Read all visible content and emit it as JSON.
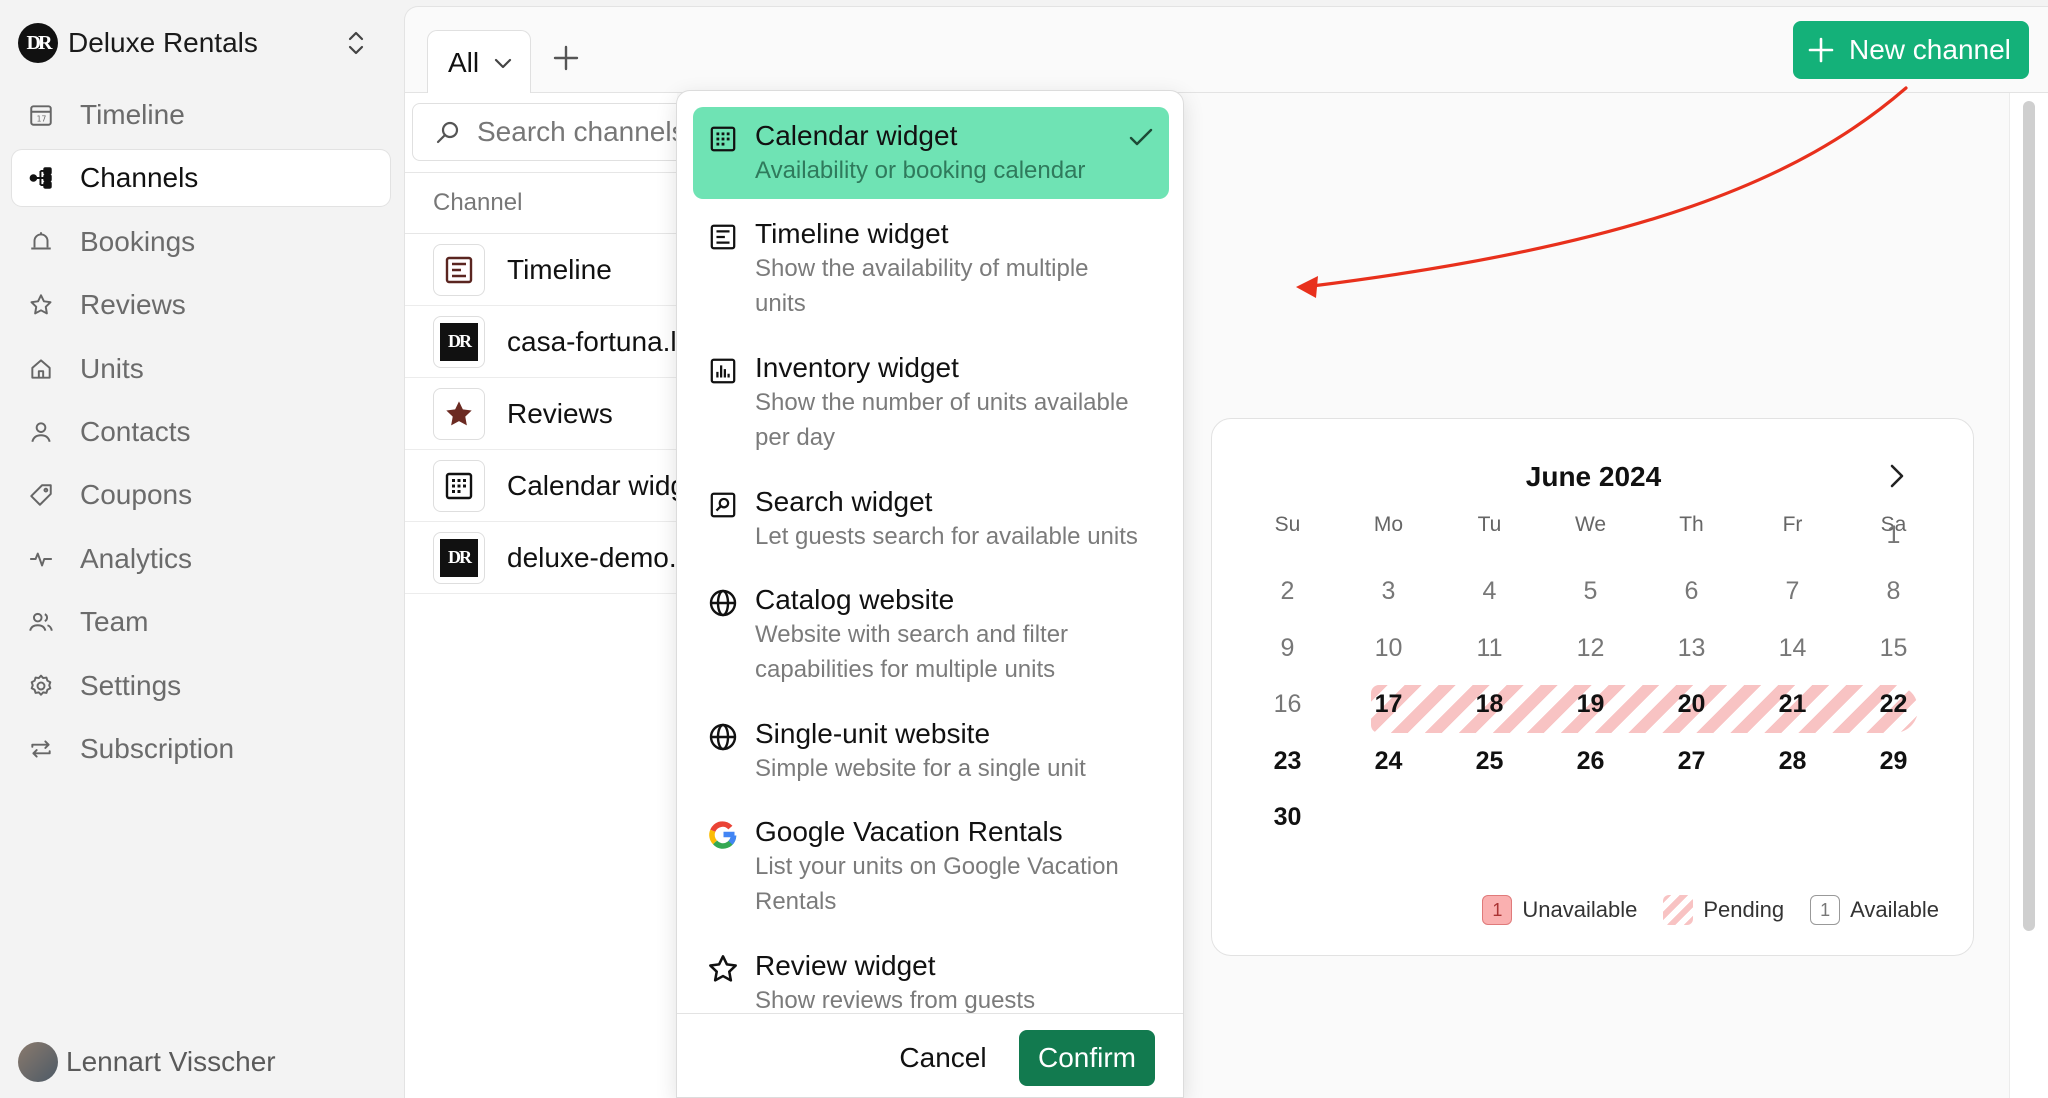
{
  "app": {
    "brand": "Deluxe Rentals",
    "logo_text": "DR",
    "user_name": "Lennart Visscher"
  },
  "sidebar": {
    "items": [
      {
        "label": "Timeline",
        "icon": "calendar-icon",
        "active": false
      },
      {
        "label": "Channels",
        "icon": "channels-icon",
        "active": true
      },
      {
        "label": "Bookings",
        "icon": "bell-icon",
        "active": false
      },
      {
        "label": "Reviews",
        "icon": "star-icon",
        "active": false
      },
      {
        "label": "Units",
        "icon": "home-icon",
        "active": false
      },
      {
        "label": "Contacts",
        "icon": "user-icon",
        "active": false
      },
      {
        "label": "Coupons",
        "icon": "tag-icon",
        "active": false
      },
      {
        "label": "Analytics",
        "icon": "pulse-icon",
        "active": false
      },
      {
        "label": "Team",
        "icon": "team-icon",
        "active": false
      },
      {
        "label": "Settings",
        "icon": "gear-icon",
        "active": false
      },
      {
        "label": "Subscription",
        "icon": "repeat-icon",
        "active": false
      }
    ]
  },
  "tabs": {
    "active": "All",
    "add_icon": "plus-icon"
  },
  "toolbar": {
    "new_channel_label": "New channel",
    "accent": "#14b179"
  },
  "channels": {
    "search_placeholder": "Search channels",
    "column_header": "Channel",
    "rows": [
      {
        "label": "Timeline",
        "icon": "timeline-widget-icon"
      },
      {
        "label": "casa-fortuna.l",
        "icon": "brand-logo-icon"
      },
      {
        "label": "Reviews",
        "icon": "star-icon"
      },
      {
        "label": "Calendar widg",
        "icon": "calendar-grid-icon"
      },
      {
        "label": "deluxe-demo.",
        "icon": "brand-logo-icon"
      }
    ]
  },
  "dropdown": {
    "options": [
      {
        "title": "Calendar widget",
        "subtitle": "Availability or booking calendar",
        "icon": "calendar-grid-icon",
        "selected": true
      },
      {
        "title": "Timeline widget",
        "subtitle": "Show the availability of multiple units",
        "icon": "timeline-widget-icon",
        "selected": false
      },
      {
        "title": "Inventory widget",
        "subtitle": "Show the number of units available per day",
        "icon": "bar-chart-icon",
        "selected": false
      },
      {
        "title": "Search widget",
        "subtitle": "Let guests search for available units",
        "icon": "search-widget-icon",
        "selected": false
      },
      {
        "title": "Catalog website",
        "subtitle": "Website with search and filter capabilities for multiple units",
        "icon": "globe-icon",
        "selected": false
      },
      {
        "title": "Single-unit website",
        "subtitle": "Simple website for a single unit",
        "icon": "globe-icon",
        "selected": false
      },
      {
        "title": "Google Vacation Rentals",
        "subtitle": "List your units on Google Vacation Rentals",
        "icon": "google-icon",
        "selected": false
      },
      {
        "title": "Review widget",
        "subtitle": "Show reviews from guests",
        "icon": "star-outline-icon",
        "selected": false
      }
    ],
    "cancel_label": "Cancel",
    "confirm_label": "Confirm",
    "selected_color": "#6fe3b4",
    "confirm_color": "#127a4f"
  },
  "calendar": {
    "month_label": "June 2024",
    "weekdays": [
      "Su",
      "Mo",
      "Tu",
      "We",
      "Th",
      "Fr",
      "Sa"
    ],
    "first_weekday_index": 6,
    "days_in_month": 30,
    "bold_days": [
      17,
      18,
      19,
      20,
      21,
      22,
      23,
      24,
      25,
      26,
      27,
      28,
      29,
      30
    ],
    "pending_days": [
      17,
      18,
      19,
      20,
      21,
      22
    ],
    "legend": {
      "unavailable": "Unavailable",
      "pending": "Pending",
      "available": "Available",
      "sample_day": "1"
    },
    "colors": {
      "unavailable": "#fab0b0",
      "pending": "#f8c3c3"
    }
  },
  "annotation": {
    "arrow_color": "#e8301c"
  }
}
